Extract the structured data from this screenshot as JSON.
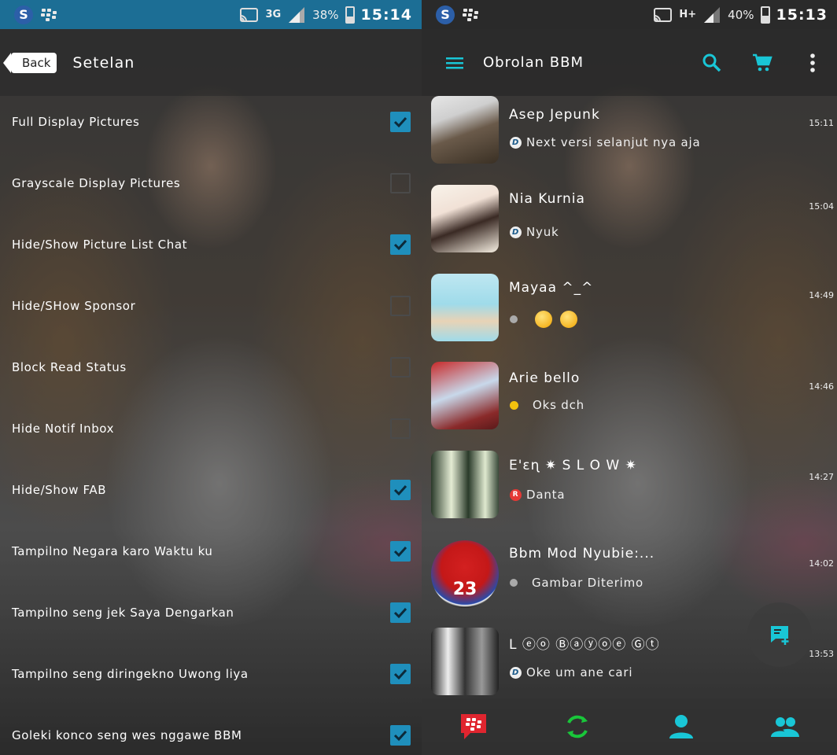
{
  "left_screen": {
    "statusbar": {
      "network": "3G",
      "battery": "38%",
      "battery_level": 0.38,
      "time": "15:14"
    },
    "appbar": {
      "back_label": "Back",
      "title": "Setelan"
    },
    "settings": [
      {
        "label": "Full Display Pictures",
        "checked": true
      },
      {
        "label": "Grayscale Display Pictures",
        "checked": false
      },
      {
        "label": "Hide/Show Picture List Chat",
        "checked": true
      },
      {
        "label": "Hide/SHow Sponsor",
        "checked": false
      },
      {
        "label": "Block Read Status",
        "checked": false
      },
      {
        "label": "Hide Notif Inbox",
        "checked": false
      },
      {
        "label": "Hide/Show FAB",
        "checked": true
      },
      {
        "label": "Tampilno Negara karo Waktu ku",
        "checked": true
      },
      {
        "label": "Tampilno seng jek Saya Dengarkan",
        "checked": true
      },
      {
        "label": "Tampilno seng diringekno Uwong liya",
        "checked": true
      },
      {
        "label": "Goleki konco seng wes nggawe BBM",
        "checked": true
      }
    ]
  },
  "right_screen": {
    "statusbar": {
      "network": "H+",
      "battery": "40%",
      "battery_level": 0.4,
      "time": "15:13"
    },
    "appbar": {
      "title": "Obrolan BBM",
      "icons": [
        "menu-icon",
        "search-icon",
        "cart-icon",
        "more-vert-icon"
      ]
    },
    "chats": [
      {
        "name": "Asep Jepunk",
        "time": "15:11",
        "message": "Next versi selanjut nya aja",
        "status": "d"
      },
      {
        "name": "Nia Kurnia",
        "time": "15:04",
        "message": "Nyuk",
        "status": "d"
      },
      {
        "name": "Mayaa ^_^",
        "time": "14:49",
        "message": "",
        "status": "grey-dot",
        "emoji_count": 2
      },
      {
        "name": "Arie bello",
        "time": "14:46",
        "message": "Oks dch",
        "status": "yellow-dot"
      },
      {
        "name": "E'ɛɳ ✷ S L O W ✷",
        "time": "14:27",
        "message": "Danta",
        "status": "r"
      },
      {
        "name": "Bbm Mod Nyubie:...",
        "time": "14:02",
        "message": "Gambar Diterimo",
        "status": "grey-dot"
      },
      {
        "name": "L ⓔⓞ Ⓑⓐⓨⓞⓔ Ⓖⓣ",
        "time": "13:53",
        "message": "Oke um ane cari",
        "status": "d"
      }
    ],
    "avatar_text": "23",
    "colors": {
      "accent_teal": "#19c6d6",
      "bbm_red": "#e0252f",
      "checkbox_blue": "#1f8fbc",
      "statusbar_blue": "#1c6e95"
    },
    "bottom_nav": [
      "bbm-chats-icon",
      "refresh-updates-icon",
      "contact-icon",
      "groups-icon"
    ]
  }
}
